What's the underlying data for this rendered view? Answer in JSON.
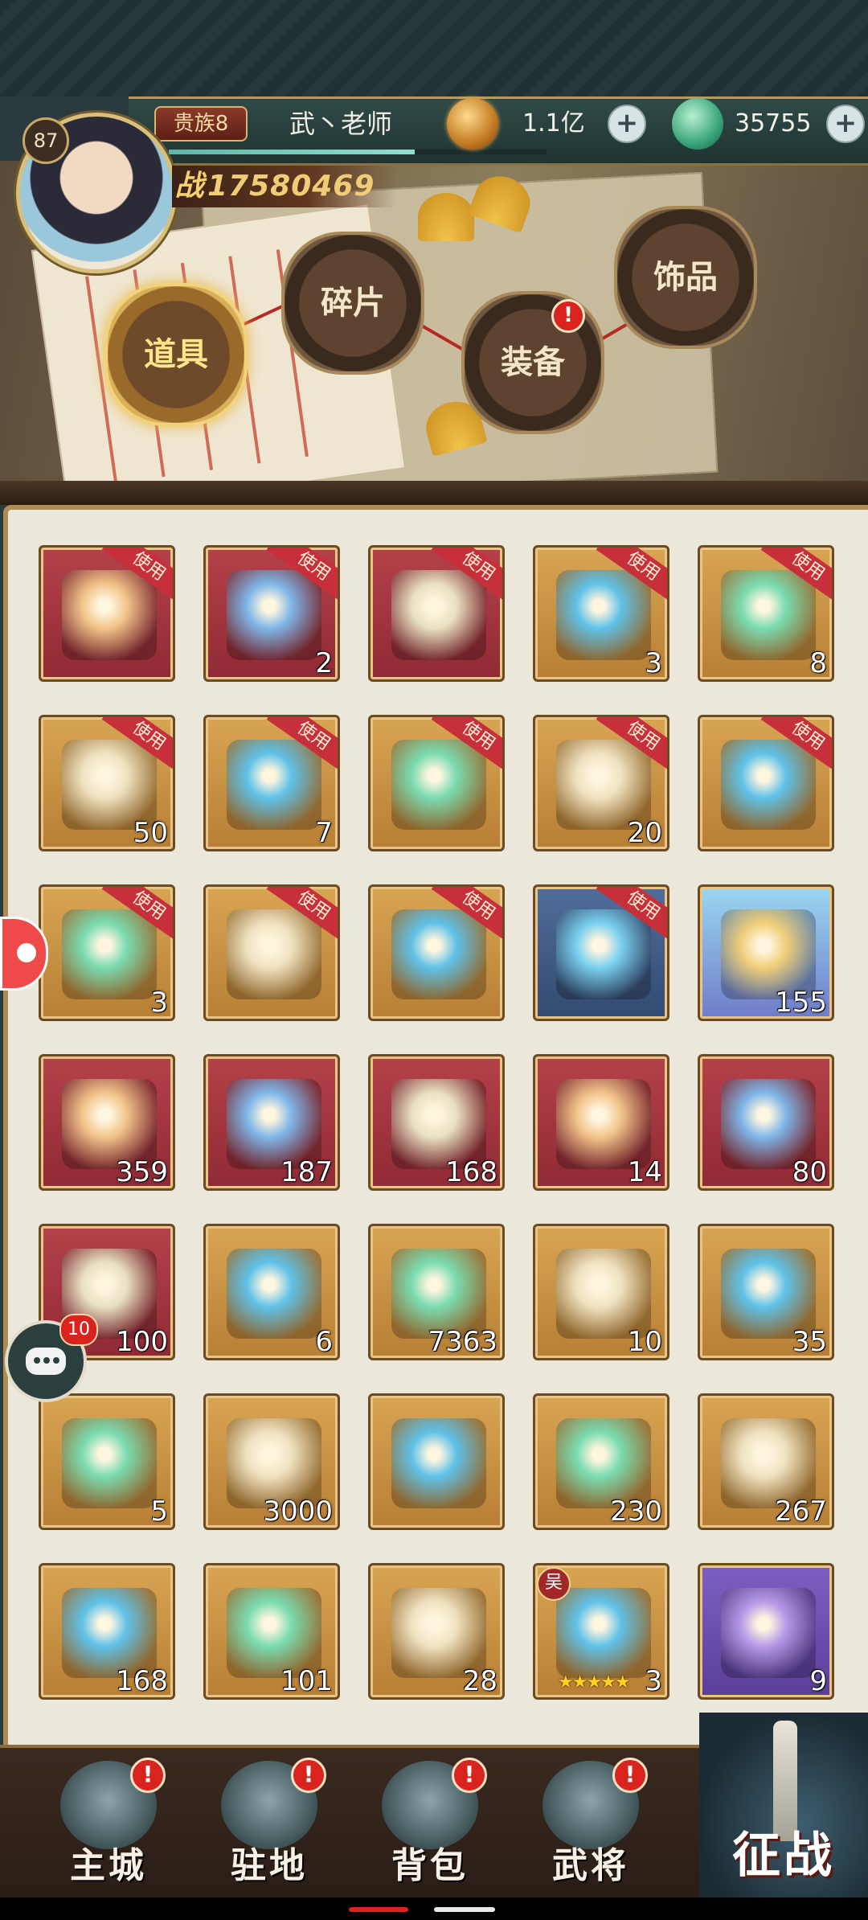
{
  "player": {
    "level": "87",
    "noble_rank": "贵族8",
    "name": "武丶老师",
    "power_prefix": "战",
    "power": "17580469",
    "xp_progress": 0.65
  },
  "currencies": [
    {
      "name": "coin",
      "value": "1.1亿"
    },
    {
      "name": "jade",
      "value": "35755"
    }
  ],
  "tabs": [
    {
      "label": "道具",
      "active": true,
      "badge": ""
    },
    {
      "label": "碎片",
      "active": false,
      "badge": ""
    },
    {
      "label": "装备",
      "active": false,
      "badge": "!"
    },
    {
      "label": "饰品",
      "active": false,
      "badge": ""
    }
  ],
  "use_label": "使用",
  "items": [
    {
      "frame": "red",
      "use": true,
      "count": ""
    },
    {
      "frame": "red",
      "use": true,
      "count": "2"
    },
    {
      "frame": "red",
      "use": true,
      "count": ""
    },
    {
      "frame": "gold",
      "use": true,
      "count": "3"
    },
    {
      "frame": "gold",
      "use": true,
      "count": "8"
    },
    {
      "frame": "gold",
      "use": true,
      "count": "50"
    },
    {
      "frame": "gold",
      "use": true,
      "count": "7"
    },
    {
      "frame": "gold",
      "use": true,
      "count": ""
    },
    {
      "frame": "gold",
      "use": true,
      "count": "20"
    },
    {
      "frame": "gold",
      "use": true,
      "count": ""
    },
    {
      "frame": "gold",
      "use": true,
      "count": "3"
    },
    {
      "frame": "gold",
      "use": true,
      "count": ""
    },
    {
      "frame": "gold",
      "use": true,
      "count": ""
    },
    {
      "frame": "blue",
      "use": true,
      "count": ""
    },
    {
      "frame": "cyan",
      "use": false,
      "count": "155"
    },
    {
      "frame": "red",
      "use": false,
      "count": "359"
    },
    {
      "frame": "red",
      "use": false,
      "count": "187"
    },
    {
      "frame": "red",
      "use": false,
      "count": "168"
    },
    {
      "frame": "red",
      "use": false,
      "count": "14"
    },
    {
      "frame": "red",
      "use": false,
      "count": "80"
    },
    {
      "frame": "red",
      "use": false,
      "count": "100"
    },
    {
      "frame": "gold",
      "use": false,
      "count": "6"
    },
    {
      "frame": "gold",
      "use": false,
      "count": "7363"
    },
    {
      "frame": "gold",
      "use": false,
      "count": "10"
    },
    {
      "frame": "gold",
      "use": false,
      "count": "35"
    },
    {
      "frame": "gold",
      "use": false,
      "count": "5"
    },
    {
      "frame": "gold",
      "use": false,
      "count": "3000"
    },
    {
      "frame": "gold",
      "use": false,
      "count": ""
    },
    {
      "frame": "gold",
      "use": false,
      "count": "230"
    },
    {
      "frame": "gold",
      "use": false,
      "count": "267"
    },
    {
      "frame": "gold",
      "use": false,
      "count": "168"
    },
    {
      "frame": "gold",
      "use": false,
      "count": "101"
    },
    {
      "frame": "gold",
      "use": false,
      "count": "28"
    },
    {
      "frame": "gold",
      "use": false,
      "count": "3",
      "faction": "吴",
      "stars": 5
    },
    {
      "frame": "purple",
      "use": false,
      "count": "9"
    }
  ],
  "chat_badge": "10",
  "nav": [
    {
      "label": "主城",
      "badge": "!"
    },
    {
      "label": "驻地",
      "badge": "!"
    },
    {
      "label": "背包",
      "badge": "!"
    },
    {
      "label": "武将",
      "badge": "!"
    }
  ],
  "battle_label": "征战"
}
